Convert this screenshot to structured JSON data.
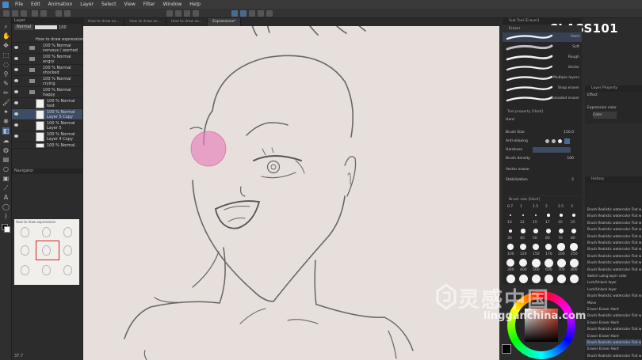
{
  "menubar": {
    "items": [
      "File",
      "Edit",
      "Animation",
      "Layer",
      "Select",
      "View",
      "Filter",
      "Window",
      "Help"
    ]
  },
  "layer_panel": {
    "title": "Layer",
    "blend_mode": "Normal",
    "opacity": "100",
    "layers": [
      {
        "l1": "How to draw expressions",
        "l2": ""
      },
      {
        "l1": "100 % Normal",
        "l2": "nervous / worried"
      },
      {
        "l1": "100 % Normal",
        "l2": "angry"
      },
      {
        "l1": "100 % Normal",
        "l2": "shocked"
      },
      {
        "l1": "100 % Normal",
        "l2": "crying"
      },
      {
        "l1": "100 % Normal",
        "l2": "happy"
      },
      {
        "l1": "100 % Normal",
        "l2": "text"
      },
      {
        "l1": "100 % Normal",
        "l2": "Layer 5 Copy"
      },
      {
        "l1": "100 % Normal",
        "l2": "Layer 5"
      },
      {
        "l1": "100 % Normal",
        "l2": "Layer 4 Copy"
      },
      {
        "l1": "100 % Normal",
        "l2": ""
      }
    ]
  },
  "navigator": {
    "title": "Navigator",
    "caption": "How to draw expressions",
    "zoom": "37.7"
  },
  "doc_tabs": [
    "How to draw ex...",
    "How to draw ex...",
    "How to draw ex...",
    "Expressions*"
  ],
  "logo": "CLASS101",
  "sub_tool": {
    "title": "Sub Tool [Eraser]",
    "group": "Eraser",
    "items": [
      "Hard",
      "Soft",
      "Rough",
      "Vector",
      "Multiple layers",
      "Snap eraser",
      "Kneaded eraser"
    ],
    "active_index": 0
  },
  "tool_property": {
    "title": "Tool property [Hard]",
    "name": "Hard",
    "brush_size_label": "Brush Size",
    "brush_size_value": "150.0",
    "anti_aliasing_label": "Anti-aliasing",
    "hardness_label": "Hardness",
    "brush_density_label": "Brush density",
    "brush_density_value": "100",
    "vector_eraser_label": "Vector eraser",
    "stabilization_label": "Stabilization",
    "stabilization_value": "2"
  },
  "brush_size": {
    "title": "Brush size [Hard]",
    "labels": [
      "0.7",
      "1",
      "1.5",
      "2",
      "2.5",
      "3",
      "10",
      "12",
      "15",
      "17",
      "20",
      "25",
      "30",
      "40",
      "50",
      "60",
      "70",
      "80",
      "100",
      "120",
      "150",
      "170",
      "200",
      "250",
      "300",
      "400",
      "500",
      "600",
      "700",
      "800"
    ]
  },
  "layer_property": {
    "title": "Layer Property",
    "effect_label": "Effect",
    "expression_color_label": "Expression color",
    "color_value": "Color"
  },
  "history": {
    "title": "History",
    "items": [
      "Brush Realistic watercolor Flat wate...",
      "Brush Realistic watercolor Flat wate...",
      "Brush Realistic watercolor Flat wate...",
      "Brush Realistic watercolor Flat wate...",
      "Brush Realistic watercolor Flat wate...",
      "Brush Realistic watercolor Flat wate...",
      "Brush Realistic watercolor Flat wate...",
      "Brush Realistic watercolor Flat wate...",
      "Brush Realistic watercolor Flat wate...",
      "Brush Realistic watercolor Flat wate...",
      "Switch using layer color",
      "Lock/Unlock layer",
      "Lock/Unlock layer",
      "Brush Realistic watercolor Flat wate...",
      "Move",
      "Eraser Eraser Hard",
      "Brush Realistic watercolor Flat wate...",
      "Eraser Eraser Hard",
      "Brush Realistic watercolor Flat wate...",
      "Eraser Eraser Hard",
      "Brush Realistic watercolor Flat wate...",
      "Eraser Eraser Hard",
      "Brush Realistic watercolor Flat wate..."
    ],
    "current_index": 20
  },
  "watermark": {
    "text": "灵感中国",
    "url": "lingganchina.com"
  },
  "colors": {
    "canvas": "#e7dfdc",
    "panel": "#2c2c2c",
    "selection": "#3e4d66",
    "blush": "#e87ab8"
  }
}
